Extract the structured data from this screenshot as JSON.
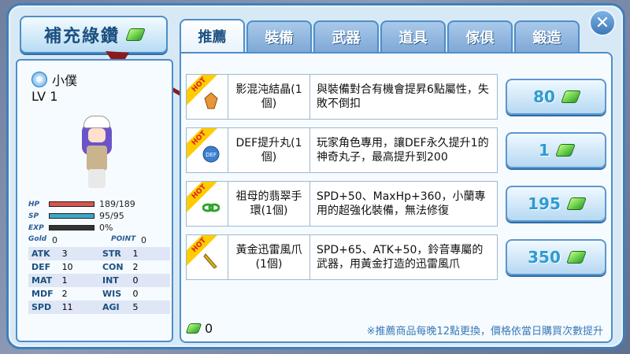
{
  "recharge": {
    "label": "補充綠鑽",
    "icon": "green-gem-icon"
  },
  "character": {
    "name": "小僕",
    "level": "LV 1",
    "bars": [
      {
        "tag": "HP",
        "value": "189/189",
        "fill": 1.0,
        "color": "#d9534f"
      },
      {
        "tag": "SP",
        "value": "95/95",
        "fill": 1.0,
        "color": "#3aa7c9"
      },
      {
        "tag": "EXP",
        "value": "0%",
        "fill": 0.0,
        "color": "#4caf50"
      }
    ],
    "gold_tag": "Gold",
    "gold": "0",
    "point_tag": "POINT",
    "point": "0",
    "stats": [
      {
        "k1": "ATK",
        "v1": "3",
        "k2": "STR",
        "v2": "1"
      },
      {
        "k1": "DEF",
        "v1": "10",
        "k2": "CON",
        "v2": "2"
      },
      {
        "k1": "MAT",
        "v1": "1",
        "k2": "INT",
        "v2": "0"
      },
      {
        "k1": "MDF",
        "v1": "2",
        "k2": "WIS",
        "v2": "0"
      },
      {
        "k1": "SPD",
        "v1": "11",
        "k2": "AGI",
        "v2": "5"
      }
    ]
  },
  "tabs": [
    "推薦",
    "裝備",
    "武器",
    "道具",
    "傢俱",
    "鍛造"
  ],
  "active_tab": 0,
  "close": {
    "label": "✕"
  },
  "hot_label": "HOT",
  "items": [
    {
      "name": "影混沌結晶(1個)",
      "desc": "與裝備對合有機會提昇6點屬性，失敗不倒扣",
      "price": "80",
      "icon": "orange-crystal-icon"
    },
    {
      "name": "DEF提升丸(1個)",
      "desc": "玩家角色專用，讓DEF永久提升1的神奇丸子，最高提升到200",
      "price": "1",
      "icon": "def-pill-icon"
    },
    {
      "name": "祖母的翡翠手環(1個)",
      "desc": "SPD+50、MaxHp+360，小蘭專用的超強化裝備，無法修復",
      "price": "195",
      "icon": "jade-bracelet-icon"
    },
    {
      "name": "黃金迅雷風爪(1個)",
      "desc": "SPD+65、ATK+50，鈴音專屬的武器，用黃金打造的迅雷風爪",
      "price": "350",
      "icon": "golden-claw-icon"
    }
  ],
  "footer": {
    "gem_count": "0",
    "note": "※推薦商品每晚12點更換，價格依當日購買次數提升"
  },
  "colors": {
    "accent": "#4e8ec8",
    "gem": "#2da22a",
    "arrow": "#8b1a1a"
  }
}
